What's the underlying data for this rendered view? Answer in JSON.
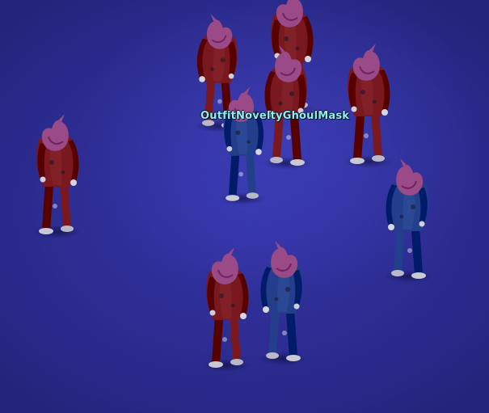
{
  "world_label": {
    "text": "OutfitNoveltyGhoulMask",
    "color": "#8ff0e6"
  },
  "scene": {
    "floor_color": "#2c2c86",
    "entities": [
      {
        "name": "zombie-red-top-center",
        "outfit": "red-jumpsuit",
        "mask": "ghoul-mask"
      },
      {
        "name": "zombie-red-top-left",
        "outfit": "red-jumpsuit",
        "mask": "ghoul-mask"
      },
      {
        "name": "zombie-red-center",
        "outfit": "red-jumpsuit",
        "mask": "ghoul-mask"
      },
      {
        "name": "zombie-red-right",
        "outfit": "red-jumpsuit",
        "mask": "ghoul-mask"
      },
      {
        "name": "zombie-blue-center",
        "outfit": "blue-jumpsuit",
        "mask": "ghoul-mask"
      },
      {
        "name": "zombie-red-far-left",
        "outfit": "red-jumpsuit",
        "mask": "ghoul-mask"
      },
      {
        "name": "zombie-blue-right",
        "outfit": "blue-jumpsuit",
        "mask": "ghoul-mask"
      },
      {
        "name": "zombie-red-bottom",
        "outfit": "red-jumpsuit",
        "mask": "ghoul-mask"
      },
      {
        "name": "zombie-blue-bottom",
        "outfit": "blue-jumpsuit",
        "mask": "ghoul-mask"
      }
    ],
    "colors": {
      "red_outfit": "#7a1820",
      "blue_outfit": "#233f8c",
      "mask": "#9a4a86"
    }
  }
}
